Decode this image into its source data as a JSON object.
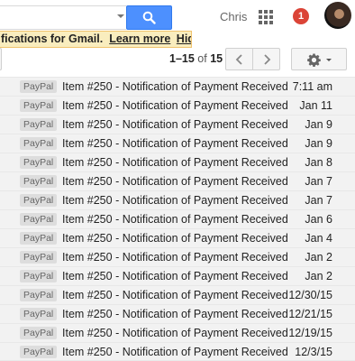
{
  "header": {
    "user_name": "Chris",
    "notification_count": "1",
    "search_icon": "search-icon",
    "apps_icon": "apps-grid-icon",
    "avatar": "avatar"
  },
  "notice": {
    "text": "fications for Gmail.",
    "learn_more": "Learn more",
    "hide": "Hide",
    "bg_color": "#f9edbe"
  },
  "toolbar": {
    "range": "1–15",
    "of": "of",
    "total": "15",
    "prev_icon": "chevron-left-icon",
    "next_icon": "chevron-right-icon",
    "settings_icon": "gear-icon"
  },
  "messages": [
    {
      "label": "PayPal",
      "subject": "Item #250 - Notification of Payment Received",
      "date": "7:11 am"
    },
    {
      "label": "PayPal",
      "subject": "Item #250 - Notification of Payment Received",
      "date": "Jan 11"
    },
    {
      "label": "PayPal",
      "subject": "Item #250 - Notification of Payment Received",
      "date": "Jan 9"
    },
    {
      "label": "PayPal",
      "subject": "Item #250 - Notification of Payment Received",
      "date": "Jan 9"
    },
    {
      "label": "PayPal",
      "subject": "Item #250 - Notification of Payment Received",
      "date": "Jan 8"
    },
    {
      "label": "PayPal",
      "subject": "Item #250 - Notification of Payment Received",
      "date": "Jan 7"
    },
    {
      "label": "PayPal",
      "subject": "Item #250 - Notification of Payment Received",
      "date": "Jan 7"
    },
    {
      "label": "PayPal",
      "subject": "Item #250 - Notification of Payment Received",
      "date": "Jan 6"
    },
    {
      "label": "PayPal",
      "subject": "Item #250 - Notification of Payment Received",
      "date": "Jan 4"
    },
    {
      "label": "PayPal",
      "subject": "Item #250 - Notification of Payment Received",
      "date": "Jan 2"
    },
    {
      "label": "PayPal",
      "subject": "Item #250 - Notification of Payment Received",
      "date": "Jan 2"
    },
    {
      "label": "PayPal",
      "subject": "Item #250 - Notification of Payment Received",
      "date": "12/30/15"
    },
    {
      "label": "PayPal",
      "subject": "Item #250 - Notification of Payment Received",
      "date": "12/21/15"
    },
    {
      "label": "PayPal",
      "subject": "Item #250 - Notification of Payment Received",
      "date": "12/19/15"
    },
    {
      "label": "PayPal",
      "subject": "Item #250 - Notification of Payment Received",
      "date": "12/3/15"
    }
  ]
}
